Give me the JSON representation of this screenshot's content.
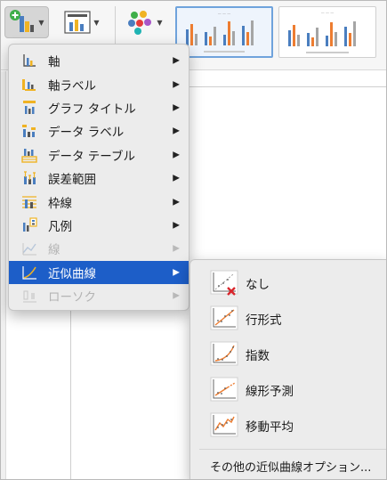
{
  "ribbon": {
    "add_chart_element_icon": "add-chart-element-icon",
    "quick_layout_icon": "quick-layout-icon",
    "change_colors_icon": "change-colors-icon",
    "style_thumbnails": [
      {
        "name": "chart-style-1",
        "selected": true
      },
      {
        "name": "chart-style-2",
        "selected": false
      }
    ]
  },
  "menu": {
    "items": [
      {
        "label": "軸",
        "icon": "axes-icon",
        "enabled": true
      },
      {
        "label": "軸ラベル",
        "icon": "axis-titles-icon",
        "enabled": true
      },
      {
        "label": "グラフ タイトル",
        "icon": "chart-title-icon",
        "enabled": true
      },
      {
        "label": "データ ラベル",
        "icon": "data-labels-icon",
        "enabled": true
      },
      {
        "label": "データ テーブル",
        "icon": "data-table-icon",
        "enabled": true
      },
      {
        "label": "誤差範囲",
        "icon": "error-bars-icon",
        "enabled": true
      },
      {
        "label": "枠線",
        "icon": "gridlines-icon",
        "enabled": true
      },
      {
        "label": "凡例",
        "icon": "legend-icon",
        "enabled": true
      },
      {
        "label": "線",
        "icon": "lines-icon",
        "enabled": false
      },
      {
        "label": "近似曲線",
        "icon": "trendline-icon",
        "enabled": true,
        "highlighted": true
      },
      {
        "label": "ローソク",
        "icon": "up-down-bars-icon",
        "enabled": false
      }
    ]
  },
  "submenu": {
    "items": [
      {
        "label": "なし",
        "icon": "trendline-none-icon"
      },
      {
        "label": "行形式",
        "icon": "trendline-linear-icon"
      },
      {
        "label": "指数",
        "icon": "trendline-exponential-icon"
      },
      {
        "label": "線形予測",
        "icon": "trendline-linear-forecast-icon"
      },
      {
        "label": "移動平均",
        "icon": "trendline-moving-average-icon"
      }
    ],
    "more_options": "その他の近似曲線オプション..."
  },
  "colors": {
    "highlight": "#1d5ec8",
    "bar_blue": "#4a7ebf",
    "bar_orange": "#ed7d31",
    "bar_gray": "#a5a5a5",
    "delete_red": "#d9262c"
  }
}
